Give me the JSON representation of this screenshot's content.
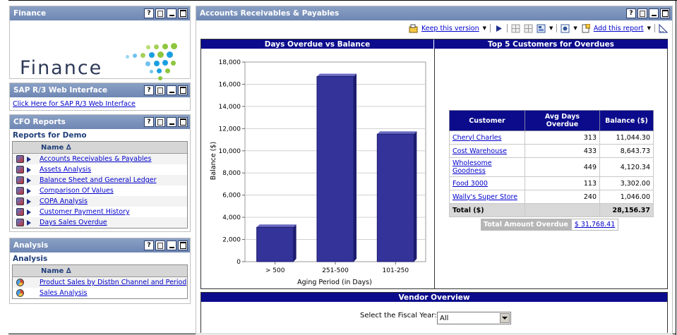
{
  "finance": {
    "title": "Finance",
    "logo_text": "Finance"
  },
  "sap": {
    "title": "SAP R/3 Web Interface",
    "link": "Click Here for SAP R/3 Web Interface"
  },
  "cfo": {
    "title": "CFO Reports",
    "section": "Reports for Demo",
    "column": "Name ∆",
    "items": [
      "Accounts Receivables & Payables",
      "Assets Analysis",
      "Balance Sheet and General Ledger",
      "Comparison Of Values",
      "COPA Analysis",
      "Customer Payment History",
      "Days Sales Overdue"
    ]
  },
  "analysis": {
    "title": "Analysis",
    "section": "Analysis",
    "column": "Name ∆",
    "items": [
      "Product Sales by Distbn Channel and Period",
      "Sales Analysis"
    ]
  },
  "main": {
    "title": "Accounts Receivables & Payables",
    "toolbar": {
      "keep_version": "Keep this version",
      "add_report": "Add this report"
    },
    "help_label": "?",
    "chart_header": "Days Overdue vs Balance",
    "top5_header": "Top 5 Customers for Overdues",
    "vendor_header": "Vendor Overview",
    "fiscal_label": "Select the Fiscal Year:",
    "fiscal_value": "All",
    "table": {
      "headers": [
        "Customer",
        "Avg Days Overdue",
        "Balance ($)"
      ],
      "rows": [
        {
          "customer": "Cheryl Charles",
          "days": "313",
          "balance": "11,044.30"
        },
        {
          "customer": "Cost Warehouse",
          "days": "433",
          "balance": "8,643.73"
        },
        {
          "customer": "Wholesome Goodness",
          "days": "449",
          "balance": "4,120.34"
        },
        {
          "customer": "Food 3000",
          "days": "113",
          "balance": "3,302.00"
        },
        {
          "customer": "Wally's Super Store",
          "days": "240",
          "balance": "1,046.00"
        }
      ],
      "total_label": "Total ($)",
      "total_value": "28,156.37"
    },
    "total_overdue_label": "Total Amount Overdue",
    "total_overdue_value": "$ 31,768.41"
  },
  "colors": {
    "portlet_header": "#7890bb",
    "bar_fill": "#33339a",
    "table_header": "#0b0b8c"
  },
  "chart_data": {
    "type": "bar",
    "categories": [
      "> 500",
      "251-500",
      "101-250"
    ],
    "values": [
      3100,
      16700,
      11500
    ],
    "xlabel": "Aging Period (in Days)",
    "ylabel": "Balance ($)",
    "ylim": [
      0,
      18000
    ],
    "yticks": [
      "0",
      "2,000",
      "4,000",
      "6,000",
      "8,000",
      "10,000",
      "12,000",
      "14,000",
      "16,000",
      "18,000"
    ],
    "grid": true
  }
}
